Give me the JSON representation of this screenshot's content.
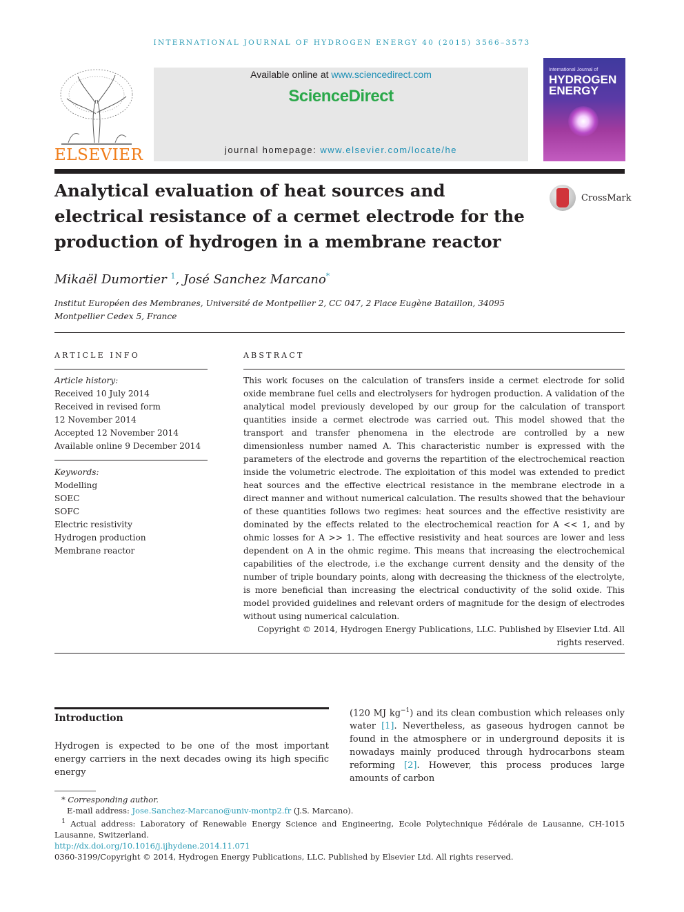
{
  "running_head": "INTERNATIONAL JOURNAL OF HYDROGEN ENERGY 40 (2015) 3566–3573",
  "header": {
    "publisher_logo_text": "ELSEVIER",
    "available_prefix": "Available online at ",
    "available_link": "www.sciencedirect.com",
    "platform_name": "ScienceDirect",
    "homepage_prefix": "journal homepage: ",
    "homepage_link": "www.elsevier.com/locate/he",
    "cover": {
      "small_text": "International Journal of",
      "title_line1": "HYDROGEN",
      "title_line2": "ENERGY"
    }
  },
  "article": {
    "title": "Analytical evaluation of heat sources and electrical resistance of a cermet electrode for the production of hydrogen in a membrane reactor",
    "crossmark_label": "CrossMark",
    "authors": [
      {
        "name": "Mikaël Dumortier",
        "marker": "1"
      },
      {
        "name": "José Sanchez Marcano",
        "marker": "*"
      }
    ],
    "author_separator": ", ",
    "affiliation": "Institut Européen des Membranes, Université de Montpellier 2, CC 047, 2 Place Eugène Bataillon, 34095 Montpellier Cedex 5, France"
  },
  "article_info": {
    "heading": "ARTICLE INFO",
    "history_label": "Article history:",
    "history": [
      "Received 10 July 2014",
      "Received in revised form",
      "12 November 2014",
      "Accepted 12 November 2014",
      "Available online 9 December 2014"
    ],
    "keywords_label": "Keywords:",
    "keywords": [
      "Modelling",
      "SOEC",
      "SOFC",
      "Electric resistivity",
      "Hydrogen production",
      "Membrane reactor"
    ]
  },
  "abstract": {
    "heading": "ABSTRACT",
    "text": "This work focuses on the calculation of transfers inside a cermet electrode for solid oxide membrane fuel cells and electrolysers for hydrogen production. A validation of the analytical model previously developed by our group for the calculation of transport quantities inside a cermet electrode was carried out. This model showed that the transport and transfer phenomena in the electrode are controlled by a new dimensionless number named A. This characteristic number is expressed with the parameters of the electrode and governs the repartition of the electrochemical reaction inside the volumetric electrode. The exploitation of this model was extended to predict heat sources and the effective electrical resistance in the membrane electrode in a direct manner and without numerical calculation. The results showed that the behaviour of these quantities follows two regimes: heat sources and the effective resistivity are dominated by the effects related to the electrochemical reaction for A << 1, and by ohmic losses for A >> 1. The effective resistivity and heat sources are lower and less dependent on A in the ohmic regime. This means that increasing the electrochemical capabilities of the electrode, i.e the exchange current density and the density of the number of triple boundary points, along with decreasing the thickness of the electrolyte, is more beneficial than increasing the electrical conductivity of the solid oxide. This model provided guidelines and relevant orders of magnitude for the design of electrodes without using numerical calculation.",
    "copyright": "Copyright © 2014, Hydrogen Energy Publications, LLC. Published by Elsevier Ltd. All rights reserved."
  },
  "introduction": {
    "heading": "Introduction",
    "col1": "Hydrogen is expected to be one of the most important energy carriers in the next decades owing its high specific energy",
    "col2_parts": [
      "(120 MJ kg",
      "−1",
      ") and its clean combustion which releases only water ",
      "[1]",
      ". Nevertheless, as gaseous hydrogen cannot be found in the atmosphere or in underground deposits it is nowadays mainly produced through hydrocarbons steam reforming ",
      "[2]",
      ". However, this process produces large amounts of carbon"
    ]
  },
  "footnotes": {
    "corresponding_marker": "*",
    "corresponding_text": "Corresponding author.",
    "email_label": "E-mail address: ",
    "email": "Jose.Sanchez-Marcano@univ-montp2.fr",
    "email_suffix": " (J.S. Marcano).",
    "note1_marker": "1",
    "note1_text": "Actual address: Laboratory of Renewable Energy Science and Engineering, Ecole Polytechnique Fédérale de Lausanne, CH-1015 Lausanne, Switzerland.",
    "doi": "http://dx.doi.org/10.1016/j.ijhydene.2014.11.071",
    "issn_copyright": "0360-3199/Copyright © 2014, Hydrogen Energy Publications, LLC. Published by Elsevier Ltd. All rights reserved."
  }
}
